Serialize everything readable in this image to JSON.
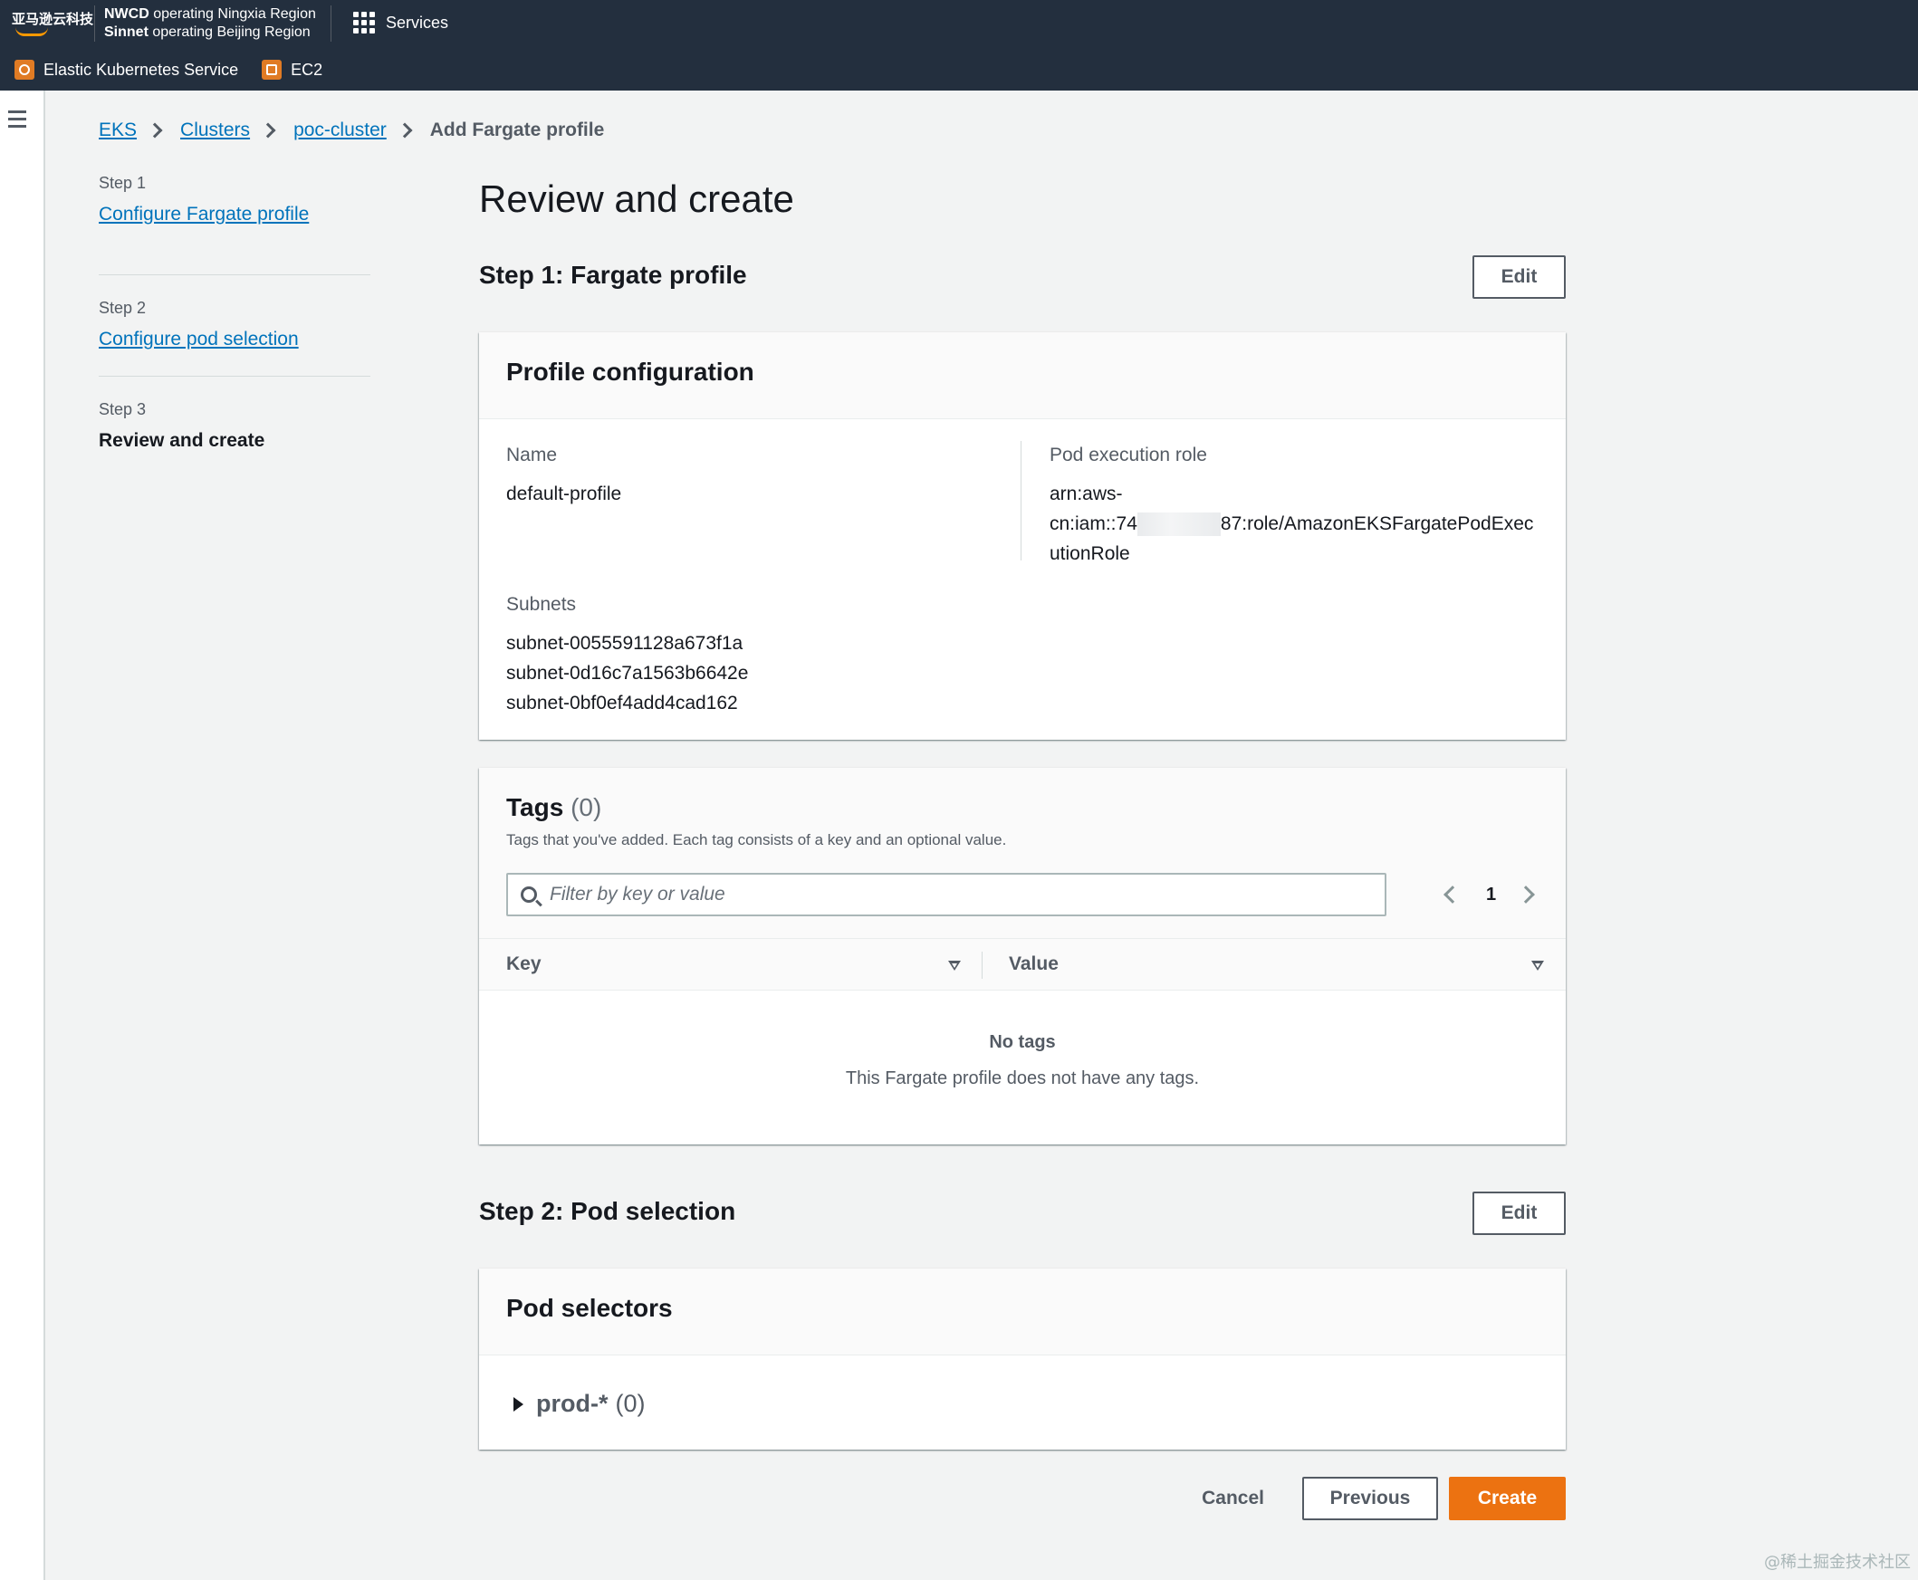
{
  "topnav": {
    "logo_text": "亚马逊云科技",
    "region_line1_bold": "NWCD",
    "region_line1_rest": "operating Ningxia Region",
    "region_line2_bold": "Sinnet",
    "region_line2_rest": "operating Beijing Region",
    "services_label": "Services",
    "favorites": [
      {
        "label": "Elastic Kubernetes Service",
        "icon": "eks-service-icon"
      },
      {
        "label": "EC2",
        "icon": "ec2-service-icon"
      }
    ],
    "accent_color": "#ff9900",
    "bg_color": "#232f3e"
  },
  "breadcrumbs": {
    "items": [
      "EKS",
      "Clusters",
      "poc-cluster"
    ],
    "current": "Add Fargate profile"
  },
  "wizard": {
    "steps": [
      {
        "number": "Step 1",
        "label": "Configure Fargate profile"
      },
      {
        "number": "Step 2",
        "label": "Configure pod selection"
      },
      {
        "number": "Step 3",
        "label": "Review and create"
      }
    ]
  },
  "page": {
    "title": "Review and create"
  },
  "step1": {
    "title": "Step 1: Fargate profile",
    "edit_label": "Edit",
    "profile": {
      "header": "Profile configuration",
      "name_label": "Name",
      "name_value": "default-profile",
      "role_label": "Pod execution role",
      "role_line1": "arn:aws-",
      "role_line2_prefix": "cn:iam::74",
      "role_line2_suffix": "87:role/AmazonEKSFargatePodExec",
      "role_line3": "utionRole",
      "subnets_label": "Subnets",
      "subnets": [
        "subnet-0055591128a673f1a",
        "subnet-0d16c7a1563b6642e",
        "subnet-0bf0ef4add4cad162"
      ]
    },
    "tags": {
      "title": "Tags",
      "count": "(0)",
      "description": "Tags that you've added. Each tag consists of a key and an optional value.",
      "filter_placeholder": "Filter by key or value",
      "page_number": "1",
      "columns": [
        "Key",
        "Value"
      ],
      "empty_title": "No tags",
      "empty_description": "This Fargate profile does not have any tags."
    }
  },
  "step2": {
    "title": "Step 2: Pod selection",
    "edit_label": "Edit",
    "selectors": {
      "header": "Pod selectors",
      "item_label": "prod-*",
      "item_count": "(0)"
    }
  },
  "actions": {
    "cancel": "Cancel",
    "previous": "Previous",
    "create": "Create",
    "primary_color": "#ec7211"
  },
  "watermark": "@稀土掘金技术社区"
}
